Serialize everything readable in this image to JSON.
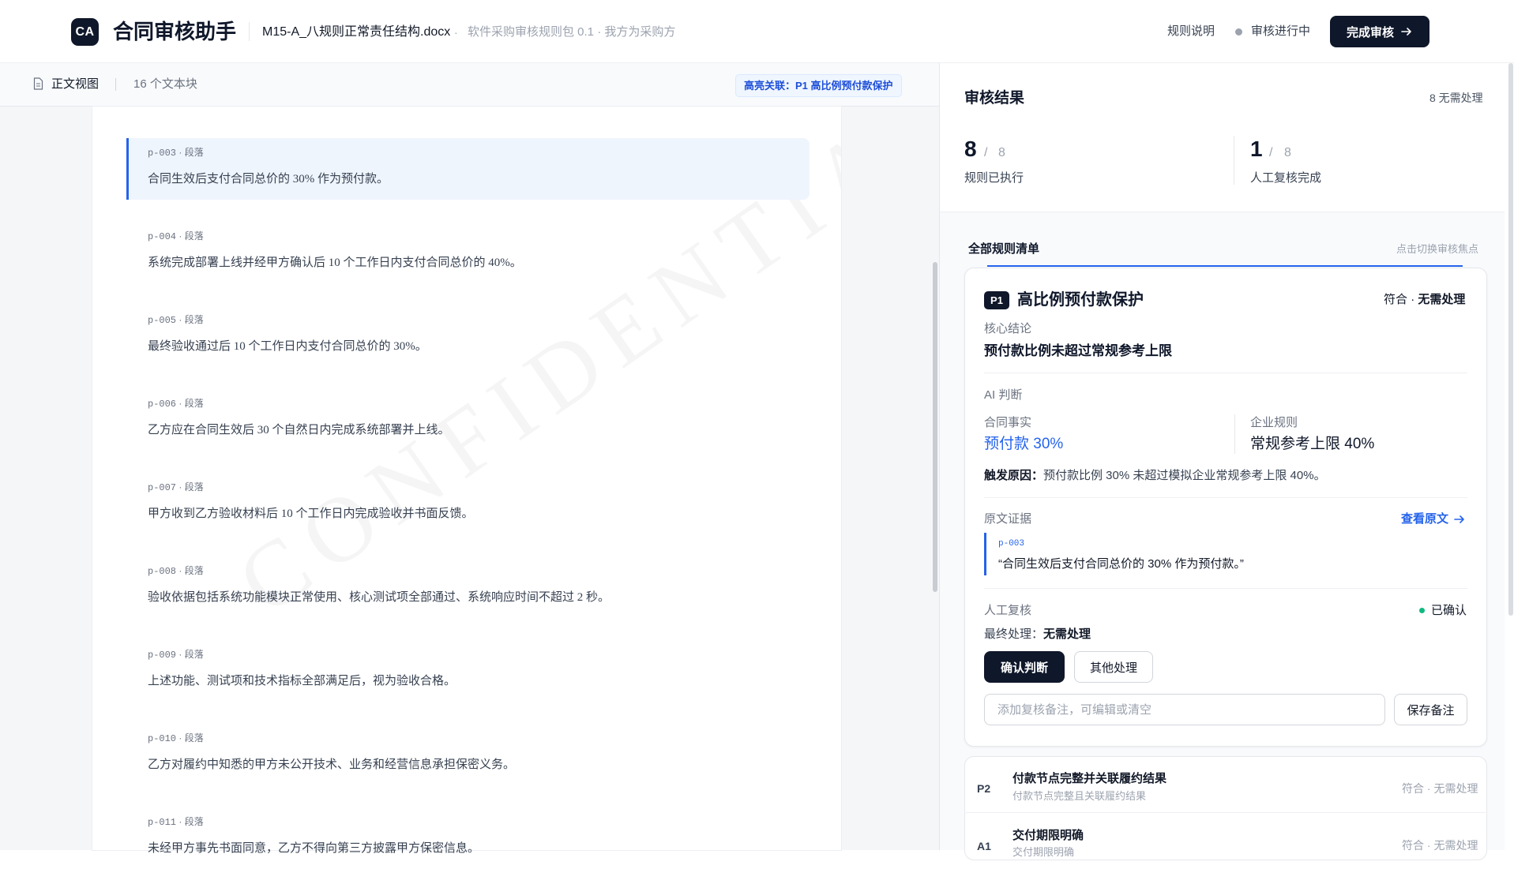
{
  "header": {
    "logo": "CA",
    "app_title": "合同审核助手",
    "file_name": "M15-A_八规则正常责任结构.docx",
    "dot": "·",
    "file_meta": "软件采购审核规则包 0.1 · 我方为采购方",
    "rule_help": "规则说明",
    "status": "审核进行中",
    "finish_button": "完成审核"
  },
  "doc_toolbar": {
    "view_label": "正文视图",
    "block_count": "16 个文本块",
    "highlight_tag": "高亮关联：P1 高比例预付款保护"
  },
  "document": {
    "watermark": "CONFIDENTIAL",
    "paragraphs": [
      {
        "id": "p-003",
        "type": "段落",
        "text": "合同生效后支付合同总价的 30% 作为预付款。"
      },
      {
        "id": "p-004",
        "type": "段落",
        "text": "系统完成部署上线并经甲方确认后 10 个工作日内支付合同总价的 40%。"
      },
      {
        "id": "p-005",
        "type": "段落",
        "text": "最终验收通过后 10 个工作日内支付合同总价的 30%。"
      },
      {
        "id": "p-006",
        "type": "段落",
        "text": "乙方应在合同生效后 30 个自然日内完成系统部署并上线。"
      },
      {
        "id": "p-007",
        "type": "段落",
        "text": "甲方收到乙方验收材料后 10 个工作日内完成验收并书面反馈。"
      },
      {
        "id": "p-008",
        "type": "段落",
        "text": "验收依据包括系统功能模块正常使用、核心测试项全部通过、系统响应时间不超过 2 秒。"
      },
      {
        "id": "p-009",
        "type": "段落",
        "text": "上述功能、测试项和技术指标全部满足后，视为验收合格。"
      },
      {
        "id": "p-010",
        "type": "段落",
        "text": "乙方对履约中知悉的甲方未公开技术、业务和经营信息承担保密义务。"
      },
      {
        "id": "p-011",
        "type": "段落",
        "text": "未经甲方事先书面同意，乙方不得向第三方披露甲方保密信息。"
      }
    ],
    "separator": "·"
  },
  "results": {
    "title": "审核结果",
    "no_action_count": "8 无需处理",
    "stats": [
      {
        "value": "8",
        "total": "8",
        "label": "规则已执行"
      },
      {
        "value": "1",
        "total": "8",
        "label": "人工复核完成"
      }
    ],
    "slash": "/",
    "list_title": "全部规则清单",
    "list_hint": "点击切换审核焦点"
  },
  "card": {
    "code": "P1",
    "title": "高比例预付款保护",
    "status_a": "符合",
    "status_sep": "·",
    "status_b": "无需处理",
    "core_label": "核心结论",
    "core_value": "预付款比例未超过常规参考上限",
    "ai_label": "AI 判断",
    "fact_label": "合同事实",
    "fact_value": "预付款 30%",
    "rule_label": "企业规则",
    "rule_value": "常规参考上限 40%",
    "trigger_label": "触发原因：",
    "trigger_text": "预付款比例 30% 未超过模拟企业常规参考上限 40%。",
    "evidence_label": "原文证据",
    "view_source": "查看原文",
    "evidence_pid": "p-003",
    "evidence_quote": "“合同生效后支付合同总价的 30% 作为预付款。”",
    "review_label": "人工复核",
    "confirmed": "已确认",
    "final_label": "最终处理：",
    "final_value": "无需处理",
    "confirm_button": "确认判断",
    "other_button": "其他处理",
    "note_placeholder": "添加复核备注，可编辑或清空",
    "save_button": "保存备注"
  },
  "rule_rows": [
    {
      "code": "P2",
      "title": "付款节点完整并关联履约结果",
      "subtitle": "付款节点完整且关联履约结果",
      "status": "符合 · 无需处理"
    },
    {
      "code": "A1",
      "title": "交付期限明确",
      "subtitle": "交付期限明确",
      "status": "符合 · 无需处理"
    }
  ],
  "colors": {
    "accent": "#2563eb",
    "dark": "#0f172a",
    "confirmed": "#10b981"
  }
}
